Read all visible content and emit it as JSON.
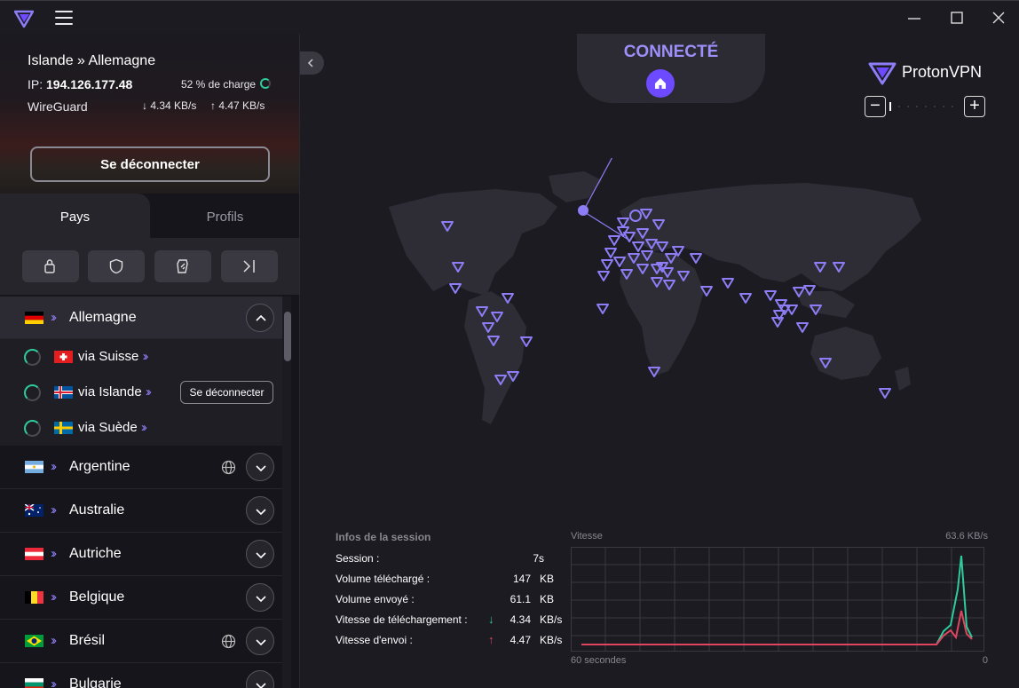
{
  "window": {
    "minimize": "—",
    "maximize": "☐",
    "close": "✕"
  },
  "connection": {
    "route": "Islande » Allemagne",
    "ip_label": "IP:",
    "ip": "194.126.177.48",
    "load": "52 % de charge",
    "protocol": "WireGuard",
    "download": "4.34 KB/s",
    "upload": "4.47 KB/s",
    "disconnect_label": "Se déconnecter"
  },
  "tabs": {
    "countries": "Pays",
    "profiles": "Profils"
  },
  "filters": [
    {
      "icon": "secure-core-icon"
    },
    {
      "icon": "shield-icon"
    },
    {
      "icon": "p2p-icon"
    },
    {
      "icon": "tor-icon"
    }
  ],
  "countries": {
    "germany": "Allemagne",
    "argentina": "Argentine",
    "australia": "Australie",
    "austria": "Autriche",
    "belgium": "Belgique",
    "brazil": "Brésil",
    "bulgaria": "Bulgarie"
  },
  "servers": [
    {
      "name": "via Suisse"
    },
    {
      "name": "via Islande",
      "action": "Se déconnecter"
    },
    {
      "name": "via Suède"
    }
  ],
  "status": "CONNECTÉ",
  "brand": {
    "name": "ProtonVPN"
  },
  "zoom": {
    "minus": "−",
    "plus": "+"
  },
  "session": {
    "title": "Infos de la session",
    "rows": [
      {
        "label": "Session :",
        "value": "7s",
        "unit": ""
      },
      {
        "label": "Volume téléchargé :",
        "value": "147",
        "unit": "KB"
      },
      {
        "label": "Volume envoyé :",
        "value": "61.1",
        "unit": "KB"
      },
      {
        "label": "Vitesse de téléchargement :",
        "value": "4.34",
        "unit": "KB/s",
        "arrow": "↓"
      },
      {
        "label": "Vitesse d'envoi :",
        "value": "4.47",
        "unit": "KB/s",
        "arrow": "↑"
      }
    ]
  },
  "speed_graph": {
    "title": "Vitesse",
    "max_label": "63.6  KB/s",
    "x_left": "60 secondes",
    "x_right": "0"
  },
  "colors": {
    "accent": "#6d4aff",
    "connected": "#9d8ff9",
    "download": "#2ecc9a",
    "upload": "#e0455f"
  }
}
